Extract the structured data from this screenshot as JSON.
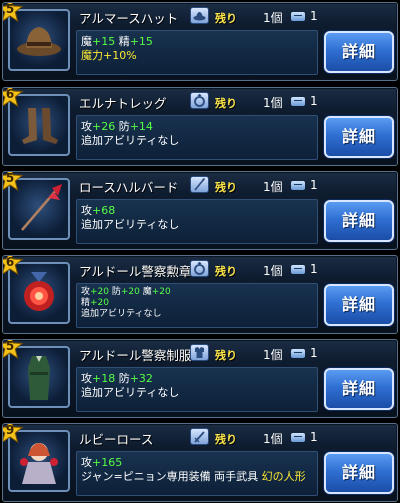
{
  "items": [
    {
      "rarity": "5",
      "name": "アルマースハット",
      "slot_icon": "hat-icon",
      "remaining_label": "残り",
      "owned": "1個",
      "stock": "1",
      "stat_lines": [
        [
          {
            "t": "魔",
            "c": "lbl"
          },
          {
            "t": "+15",
            "c": "green"
          },
          {
            "t": " 精",
            "c": "lbl"
          },
          {
            "t": "+15",
            "c": "green"
          }
        ],
        [
          {
            "t": "魔力+10%",
            "c": "yellow"
          }
        ]
      ],
      "small": false,
      "detail_label": "詳細"
    },
    {
      "rarity": "6",
      "name": "エルナトレッグ",
      "slot_icon": "ring-icon",
      "remaining_label": "残り",
      "owned": "1個",
      "stock": "1",
      "stat_lines": [
        [
          {
            "t": "攻",
            "c": "lbl"
          },
          {
            "t": "+26",
            "c": "green"
          },
          {
            "t": " 防",
            "c": "lbl"
          },
          {
            "t": "+14",
            "c": "green"
          }
        ],
        [
          {
            "t": "追加アビリティなし",
            "c": "lbl"
          }
        ]
      ],
      "small": false,
      "detail_label": "詳細"
    },
    {
      "rarity": "5",
      "name": "ロースハルバード",
      "slot_icon": "spear-icon",
      "remaining_label": "残り",
      "owned": "1個",
      "stock": "1",
      "stat_lines": [
        [
          {
            "t": "攻",
            "c": "lbl"
          },
          {
            "t": "+68",
            "c": "green"
          }
        ],
        [
          {
            "t": "追加アビリティなし",
            "c": "lbl"
          }
        ]
      ],
      "small": false,
      "detail_label": "詳細"
    },
    {
      "rarity": "6",
      "name": "アルドール警察勲章",
      "slot_icon": "ring-icon",
      "remaining_label": "残り",
      "owned": "1個",
      "stock": "1",
      "stat_lines": [
        [
          {
            "t": "攻",
            "c": "lbl"
          },
          {
            "t": "+20",
            "c": "green"
          },
          {
            "t": " 防",
            "c": "lbl"
          },
          {
            "t": "+20",
            "c": "green"
          },
          {
            "t": " 魔",
            "c": "lbl"
          },
          {
            "t": "+20",
            "c": "green"
          }
        ],
        [
          {
            "t": "精",
            "c": "lbl"
          },
          {
            "t": "+20",
            "c": "green"
          }
        ],
        [
          {
            "t": "追加アビリティなし",
            "c": "lbl"
          }
        ]
      ],
      "small": true,
      "detail_label": "詳細"
    },
    {
      "rarity": "5",
      "name": "アルドール警察制服",
      "slot_icon": "armor-icon",
      "remaining_label": "残り",
      "owned": "1個",
      "stock": "1",
      "stat_lines": [
        [
          {
            "t": "攻",
            "c": "lbl"
          },
          {
            "t": "+18",
            "c": "green"
          },
          {
            "t": " 防",
            "c": "lbl"
          },
          {
            "t": "+32",
            "c": "green"
          }
        ],
        [
          {
            "t": "追加アビリティなし",
            "c": "lbl"
          }
        ]
      ],
      "small": false,
      "detail_label": "詳細"
    },
    {
      "rarity": "9",
      "name": "ルビーロース",
      "slot_icon": "sword-icon",
      "remaining_label": "残り",
      "owned": "1個",
      "stock": "1",
      "stat_lines": [
        [
          {
            "t": "攻",
            "c": "lbl"
          },
          {
            "t": "+165",
            "c": "green"
          }
        ],
        [
          {
            "t": "ジャン=ピニョン専用装備 両手武具 ",
            "c": "lbl"
          },
          {
            "t": "幻の人形",
            "c": "yellow"
          }
        ]
      ],
      "small": false,
      "detail_label": "詳細"
    }
  ]
}
